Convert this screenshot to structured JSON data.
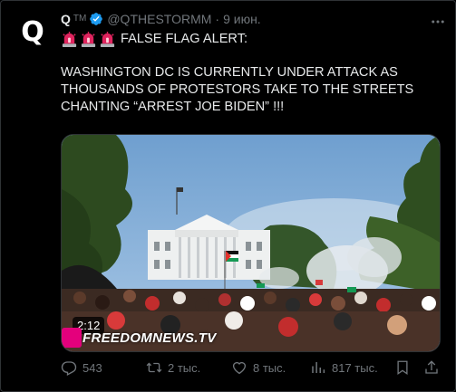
{
  "author": {
    "avatar_letter": "Q",
    "name": "Q",
    "tm": "TM",
    "handle": "@QTHESTORMM",
    "separator": "·",
    "time": "9 июн."
  },
  "tweet": {
    "headline": "FALSE FLAG ALERT:",
    "body": "WASHINGTON DC IS CURRENTLY UNDER ATTACK AS THOUSANDS OF PROTESTORS TAKE TO THE STREETS CHANTING “ARREST JOE BIDEN” !!!",
    "emoji": "police-light-icon"
  },
  "media": {
    "duration": "2:12",
    "watermark": "FREEDOMNEWS.TV"
  },
  "actions": {
    "replies": "543",
    "retweets": "2 тыс.",
    "likes": "8 тыс.",
    "views": "817 тыс."
  },
  "colors": {
    "background": "#000000",
    "text": "#e7e9ea",
    "muted": "#71767b",
    "verified": "#1d9bf0",
    "siren": "#e0245e",
    "watermark_pink": "#e4007c"
  }
}
